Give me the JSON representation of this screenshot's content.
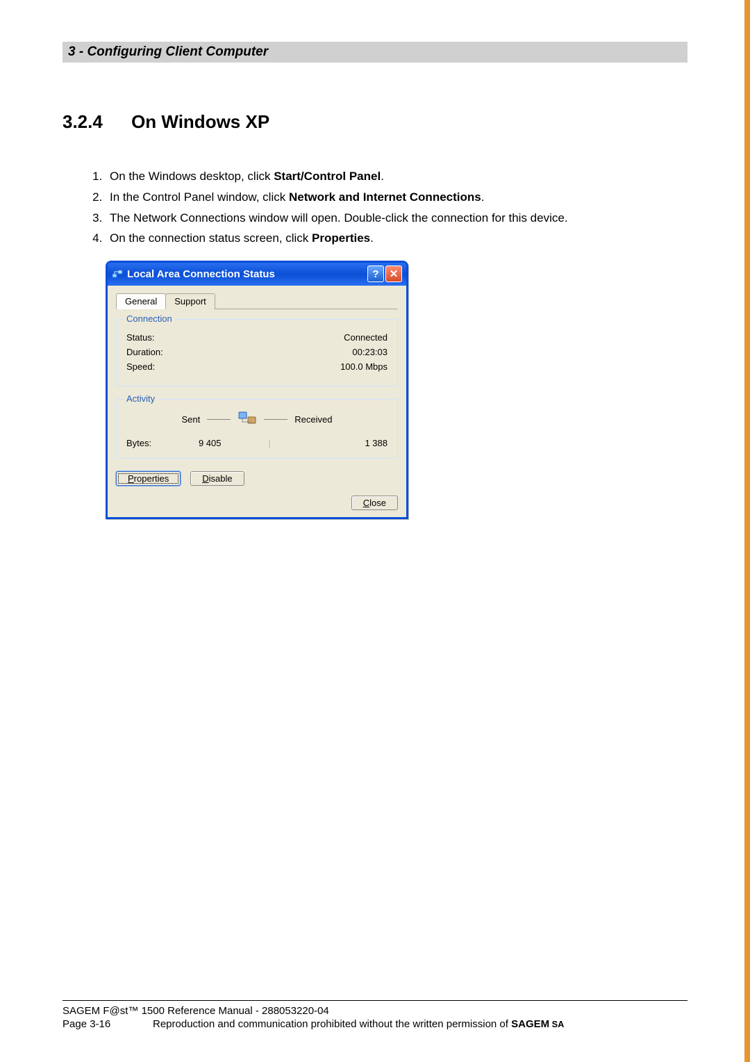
{
  "header": {
    "title": "3 - Configuring Client Computer"
  },
  "section": {
    "number": "3.2.4",
    "title": "On Windows XP"
  },
  "steps": [
    {
      "prefix": "On the Windows desktop, click ",
      "bold": "Start/Control Panel",
      "suffix": "."
    },
    {
      "prefix": "In the Control Panel window, click ",
      "bold": "Network and Internet Connections",
      "suffix": "."
    },
    {
      "prefix": "The Network Connections window will open. Double-click the connection for this device.",
      "bold": "",
      "suffix": ""
    },
    {
      "prefix": "On the connection status screen, click ",
      "bold": "Properties",
      "suffix": "."
    }
  ],
  "dialog": {
    "title": "Local Area Connection Status",
    "tabs": {
      "general": "General",
      "support": "Support"
    },
    "connection": {
      "legend": "Connection",
      "status_label": "Status:",
      "status_value": "Connected",
      "duration_label": "Duration:",
      "duration_value": "00:23:03",
      "speed_label": "Speed:",
      "speed_value": "100.0 Mbps"
    },
    "activity": {
      "legend": "Activity",
      "sent_label": "Sent",
      "received_label": "Received",
      "bytes_label": "Bytes:",
      "bytes_sent": "9 405",
      "bytes_received": "1 388"
    },
    "buttons": {
      "properties_access": "P",
      "properties_rest": "roperties",
      "disable_access": "D",
      "disable_rest": "isable",
      "close_access": "C",
      "close_rest": "lose"
    }
  },
  "footer": {
    "line1": "SAGEM F@st™ 1500 Reference Manual - 288053220-04",
    "page": "Page 3-16",
    "line2_text": "Reproduction and communication prohibited without the written permission of ",
    "brand": "SAGEM",
    "sa": " SA"
  }
}
